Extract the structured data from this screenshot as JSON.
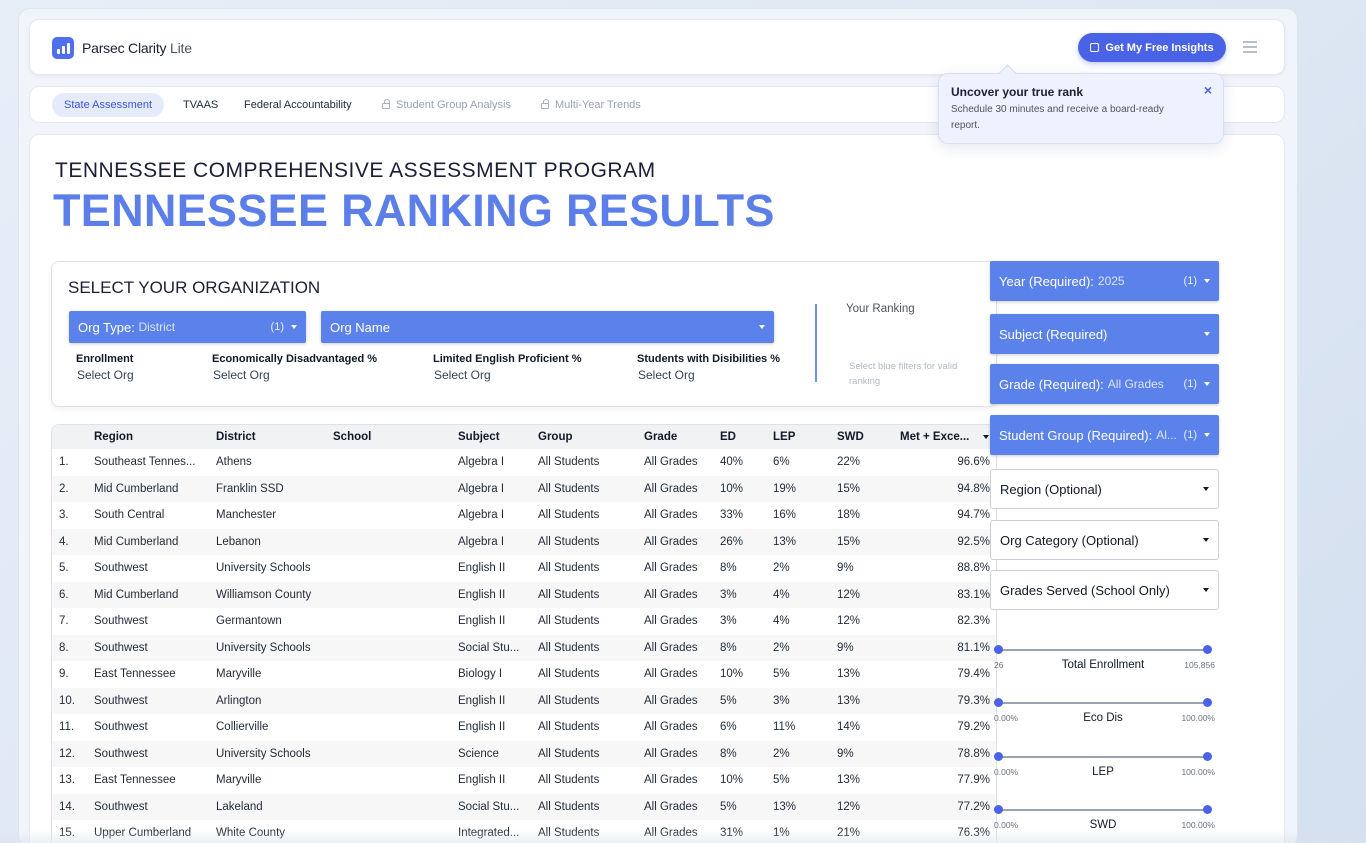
{
  "app": {
    "brand": "Parsec Clarity",
    "brand_suffix": "Lite",
    "cta_label": "Get My Free Insights"
  },
  "tabs": [
    {
      "label": "State Assessment",
      "active": true,
      "locked": false
    },
    {
      "label": "TVAAS",
      "active": false,
      "locked": false
    },
    {
      "label": "Federal Accountability",
      "active": false,
      "locked": false
    },
    {
      "label": "Student Group Analysis",
      "active": false,
      "locked": true
    },
    {
      "label": "Multi-Year Trends",
      "active": false,
      "locked": true
    }
  ],
  "popover": {
    "title": "Uncover your true rank",
    "body": "Schedule 30 minutes and receive a board-ready report.",
    "close": "×"
  },
  "page": {
    "kicker": "TENNESSEE COMPREHENSIVE ASSESSMENT PROGRAM",
    "title": "TENNESSEE RANKING RESULTS"
  },
  "org": {
    "heading": "SELECT YOUR ORGANIZATION",
    "org_type_label": "Org Type:",
    "org_type_value": "District",
    "org_type_count": "(1)",
    "org_name_label": "Org Name",
    "stats": [
      {
        "label": "Enrollment",
        "value": "Select Org"
      },
      {
        "label": "Economically Disadvantaged %",
        "value": "Select Org"
      },
      {
        "label": "Limited English Proficient %",
        "value": "Select Org"
      },
      {
        "label": "Students with Disibilities %",
        "value": "Select Org"
      }
    ],
    "ranking_label": "Your Ranking",
    "ranking_hint": "Select blue filters for valid ranking"
  },
  "table": {
    "columns": [
      "Region",
      "District",
      "School",
      "Subject",
      "Group",
      "Grade",
      "ED",
      "LEP",
      "SWD",
      "Met + Exce..."
    ],
    "rows": [
      {
        "n": "1.",
        "region": "Southeast Tennes...",
        "district": "Athens",
        "school": "",
        "subject": "Algebra I",
        "group": "All Students",
        "grade": "All Grades",
        "ed": "40%",
        "lep": "6%",
        "swd": "22%",
        "met": "96.6%"
      },
      {
        "n": "2.",
        "region": "Mid Cumberland",
        "district": "Franklin SSD",
        "school": "",
        "subject": "Algebra I",
        "group": "All Students",
        "grade": "All Grades",
        "ed": "10%",
        "lep": "19%",
        "swd": "15%",
        "met": "94.8%"
      },
      {
        "n": "3.",
        "region": "South Central",
        "district": "Manchester",
        "school": "",
        "subject": "Algebra I",
        "group": "All Students",
        "grade": "All Grades",
        "ed": "33%",
        "lep": "16%",
        "swd": "18%",
        "met": "94.7%"
      },
      {
        "n": "4.",
        "region": "Mid Cumberland",
        "district": "Lebanon",
        "school": "",
        "subject": "Algebra I",
        "group": "All Students",
        "grade": "All Grades",
        "ed": "26%",
        "lep": "13%",
        "swd": "15%",
        "met": "92.5%"
      },
      {
        "n": "5.",
        "region": "Southwest",
        "district": "University Schools",
        "school": "",
        "subject": "English II",
        "group": "All Students",
        "grade": "All Grades",
        "ed": "8%",
        "lep": "2%",
        "swd": "9%",
        "met": "88.8%"
      },
      {
        "n": "6.",
        "region": "Mid Cumberland",
        "district": "Williamson County",
        "school": "",
        "subject": "English II",
        "group": "All Students",
        "grade": "All Grades",
        "ed": "3%",
        "lep": "4%",
        "swd": "12%",
        "met": "83.1%"
      },
      {
        "n": "7.",
        "region": "Southwest",
        "district": "Germantown",
        "school": "",
        "subject": "English II",
        "group": "All Students",
        "grade": "All Grades",
        "ed": "3%",
        "lep": "4%",
        "swd": "12%",
        "met": "82.3%"
      },
      {
        "n": "8.",
        "region": "Southwest",
        "district": "University Schools",
        "school": "",
        "subject": "Social Stu...",
        "group": "All Students",
        "grade": "All Grades",
        "ed": "8%",
        "lep": "2%",
        "swd": "9%",
        "met": "81.1%"
      },
      {
        "n": "9.",
        "region": "East Tennessee",
        "district": "Maryville",
        "school": "",
        "subject": "Biology I",
        "group": "All Students",
        "grade": "All Grades",
        "ed": "10%",
        "lep": "5%",
        "swd": "13%",
        "met": "79.4%"
      },
      {
        "n": "10.",
        "region": "Southwest",
        "district": "Arlington",
        "school": "",
        "subject": "English II",
        "group": "All Students",
        "grade": "All Grades",
        "ed": "5%",
        "lep": "3%",
        "swd": "13%",
        "met": "79.3%"
      },
      {
        "n": "11.",
        "region": "Southwest",
        "district": "Collierville",
        "school": "",
        "subject": "English II",
        "group": "All Students",
        "grade": "All Grades",
        "ed": "6%",
        "lep": "11%",
        "swd": "14%",
        "met": "79.2%"
      },
      {
        "n": "12.",
        "region": "Southwest",
        "district": "University Schools",
        "school": "",
        "subject": "Science",
        "group": "All Students",
        "grade": "All Grades",
        "ed": "8%",
        "lep": "2%",
        "swd": "9%",
        "met": "78.8%"
      },
      {
        "n": "13.",
        "region": "East Tennessee",
        "district": "Maryville",
        "school": "",
        "subject": "English II",
        "group": "All Students",
        "grade": "All Grades",
        "ed": "10%",
        "lep": "5%",
        "swd": "13%",
        "met": "77.9%"
      },
      {
        "n": "14.",
        "region": "Southwest",
        "district": "Lakeland",
        "school": "",
        "subject": "Social Stu...",
        "group": "All Students",
        "grade": "All Grades",
        "ed": "5%",
        "lep": "13%",
        "swd": "12%",
        "met": "77.2%"
      },
      {
        "n": "15.",
        "region": "Upper Cumberland",
        "district": "White County",
        "school": "",
        "subject": "Integrated...",
        "group": "All Students",
        "grade": "All Grades",
        "ed": "31%",
        "lep": "1%",
        "swd": "21%",
        "met": "76.3%"
      }
    ]
  },
  "filters": [
    {
      "label": "Year (Required):",
      "value": "2025",
      "count": "(1)",
      "style": "blue"
    },
    {
      "label": "Subject (Required)",
      "value": "",
      "count": "",
      "style": "blue"
    },
    {
      "label": "Grade (Required):",
      "value": "All Grades",
      "count": "(1)",
      "style": "blue"
    },
    {
      "label": "Student Group (Required):",
      "value": "Al...",
      "count": "(1)",
      "style": "blue"
    },
    {
      "label": "Region (Optional)",
      "value": "",
      "count": "",
      "style": "white"
    },
    {
      "label": "Org Category (Optional)",
      "value": "",
      "count": "",
      "style": "white"
    },
    {
      "label": "Grades Served (School Only)",
      "value": "",
      "count": "",
      "style": "white"
    }
  ],
  "sliders": [
    {
      "label": "Total Enrollment",
      "min": "26",
      "max": "105,856",
      "low": 0,
      "high": 1
    },
    {
      "label": "Eco Dis",
      "min": "0.00%",
      "max": "100.00%",
      "low": 0,
      "high": 1
    },
    {
      "label": "LEP",
      "min": "0.00%",
      "max": "100.00%",
      "low": 0,
      "high": 1
    },
    {
      "label": "SWD",
      "min": "0.00%",
      "max": "100.00%",
      "low": 0,
      "high": 1
    }
  ],
  "colors": {
    "accent": "#4a63e6",
    "filter_blue": "#5b82ea",
    "headline": "#5b7ee8"
  }
}
